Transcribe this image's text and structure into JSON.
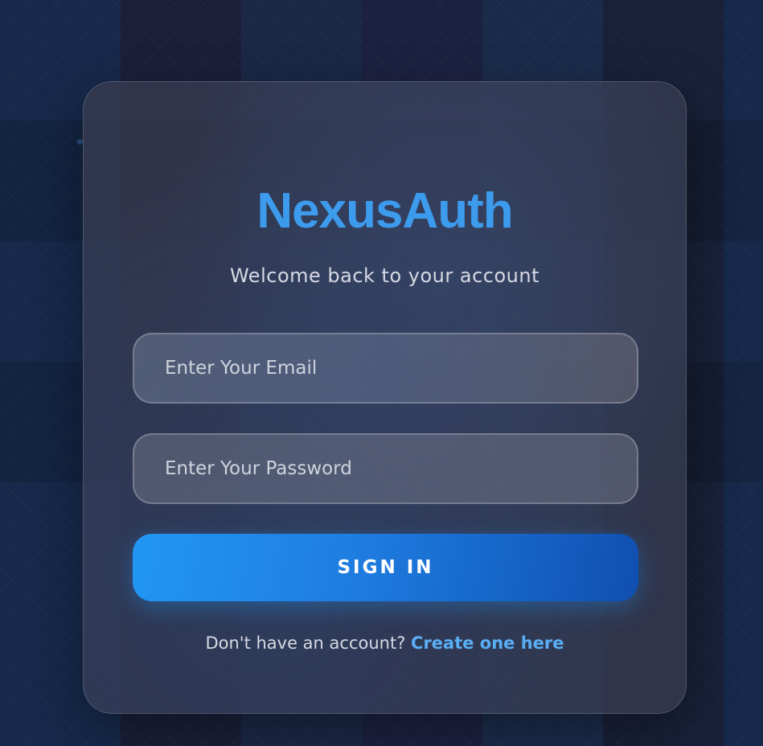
{
  "brand": {
    "name": "NexusAuth",
    "accent_color": "#3d9bee"
  },
  "subtitle": "Welcome back to your account",
  "form": {
    "email": {
      "placeholder": "Enter Your Email",
      "value": ""
    },
    "password": {
      "placeholder": "Enter Your Password",
      "value": ""
    },
    "submit_label": "SIGN IN"
  },
  "footer": {
    "prompt": "Don't have an account?",
    "link_label": "Create one here",
    "link_color": "#5aaef5"
  },
  "colors": {
    "background": "#141b33",
    "button_start": "#2296f3",
    "button_end": "#0f4fb0"
  }
}
